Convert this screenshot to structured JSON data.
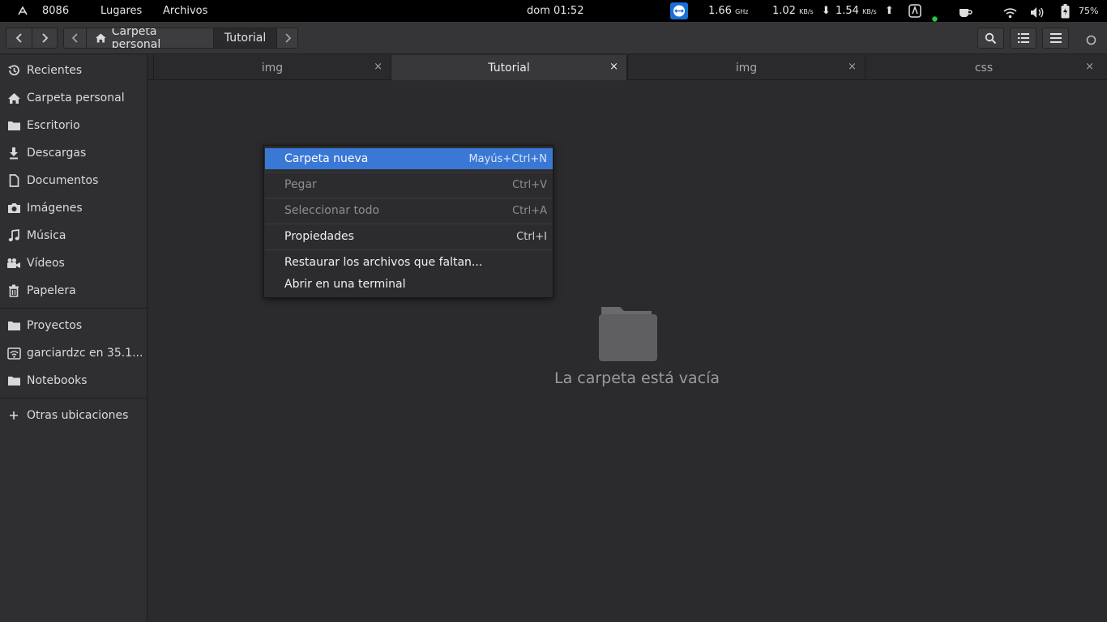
{
  "top_panel": {
    "workspace": "8086",
    "places_menu": "Lugares",
    "files_menu": "Archivos",
    "clock": "dom 01:52",
    "cpu_value": "1.66",
    "cpu_unit": "GHz",
    "download_value": "1.02",
    "download_unit": "KB/s",
    "upload_value": "1.54",
    "upload_unit": "KB/s",
    "battery": "75%",
    "icons": [
      "activities-icon",
      "teamviewer-icon",
      "arrow-down-icon",
      "arrow-up-icon",
      "app-indicator-icon",
      "status-dot-icon",
      "coffee-icon",
      "wifi-icon",
      "volume-icon",
      "battery-icon"
    ],
    "status_dot_color": "#22cc44",
    "teamviewer_color": "#1a6fd6"
  },
  "header": {
    "back_icon": "chevron-left-icon",
    "forward_icon": "chevron-right-icon",
    "path_left_icon": "chevron-left-icon",
    "path": [
      "Carpeta personal",
      "Tutorial"
    ],
    "path_right_icon": "chevron-right-icon",
    "buttons": [
      "search-icon",
      "list-view-icon",
      "menu-icon",
      "window-close-icon"
    ]
  },
  "sidebar": {
    "items": [
      {
        "label": "Recientes",
        "icon": "recent-icon"
      },
      {
        "label": "Carpeta personal",
        "icon": "home-icon"
      },
      {
        "label": "Escritorio",
        "icon": "folder-icon"
      },
      {
        "label": "Descargas",
        "icon": "download-icon"
      },
      {
        "label": "Documentos",
        "icon": "document-icon"
      },
      {
        "label": "Imágenes",
        "icon": "camera-icon"
      },
      {
        "label": "Música",
        "icon": "music-icon"
      },
      {
        "label": "Vídeos",
        "icon": "video-icon"
      },
      {
        "label": "Papelera",
        "icon": "trash-icon"
      },
      {
        "label": "Proyectos",
        "icon": "folder-icon"
      },
      {
        "label": "garciardzc en 35.1...",
        "icon": "network-icon"
      },
      {
        "label": "Notebooks",
        "icon": "folder-icon"
      },
      {
        "label": "Otras ubicaciones",
        "icon": "plus-icon"
      }
    ]
  },
  "tabs": [
    {
      "label": "img",
      "active": false
    },
    {
      "label": "Tutorial",
      "active": true
    },
    {
      "label": "img",
      "active": false
    },
    {
      "label": "css",
      "active": false
    }
  ],
  "tab_close_glyph": "×",
  "empty_state": {
    "icon": "folder-icon",
    "text": "La carpeta está vacía"
  },
  "context_menu": {
    "items": [
      {
        "label": "Carpeta nueva",
        "accel": "Mayús+Ctrl+N",
        "state": "highlighted"
      },
      {
        "label": "Pegar",
        "accel": "Ctrl+V",
        "state": "disabled"
      },
      {
        "label": "Seleccionar todo",
        "accel": "Ctrl+A",
        "state": "disabled"
      },
      {
        "label": "Propiedades",
        "accel": "Ctrl+I",
        "state": "normal"
      },
      {
        "label": "Restaurar los archivos que faltan...",
        "accel": "",
        "state": "normal"
      },
      {
        "label": "Abrir en una terminal",
        "accel": "",
        "state": "normal"
      }
    ],
    "highlight_color": "#3a78d6"
  }
}
